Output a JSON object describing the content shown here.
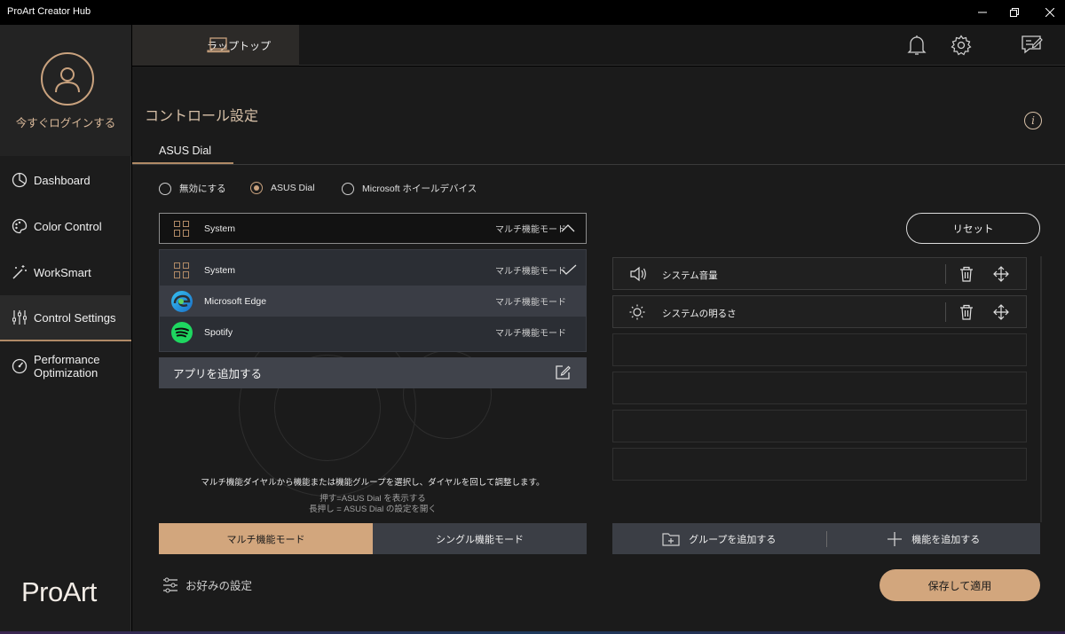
{
  "window": {
    "title": "ProArt Creator Hub"
  },
  "sidebar": {
    "login_label": "今すぐログインする",
    "items": [
      {
        "label": "Dashboard",
        "icon": "pie-chart-icon"
      },
      {
        "label": "Color Control",
        "icon": "palette-icon"
      },
      {
        "label": "WorkSmart",
        "icon": "magic-wand-icon"
      },
      {
        "label": "Control Settings",
        "icon": "sliders-icon",
        "active": true
      },
      {
        "label_line1": "Performance",
        "label_line2": "Optimization",
        "icon": "gauge-icon"
      }
    ],
    "logo": "ProArt"
  },
  "header": {
    "device_tab": "ラップトップ",
    "icons": [
      "bell-icon",
      "gear-icon",
      "feedback-icon"
    ]
  },
  "main": {
    "page_title": "コントロール設定",
    "subtab": "ASUS Dial",
    "radios": [
      {
        "label": "無効にする",
        "checked": false
      },
      {
        "label": "ASUS Dial",
        "checked": true
      },
      {
        "label": "Microsoft ホイールデバイス",
        "checked": false
      }
    ],
    "dropdown": {
      "selected_app": "System",
      "selected_mode": "マルチ機能モード",
      "options": [
        {
          "app": "System",
          "mode": "マルチ機能モード",
          "selected": true
        },
        {
          "app": "Microsoft Edge",
          "mode": "マルチ機能モード"
        },
        {
          "app": "Spotify",
          "mode": "マルチ機能モード"
        }
      ],
      "add_app": "アプリを追加する"
    },
    "help_text": "マルチ機能ダイヤルから機能または機能グループを選択し、ダイヤルを回して調整します。",
    "help_press": "押す=ASUS Dial を表示する",
    "help_long_press": "長押し = ASUS Dial の設定を開く",
    "mode_buttons": {
      "multi": "マルチ機能モード",
      "single": "シングル機能モード"
    },
    "preferences": "お好みの設定",
    "reset": "リセット",
    "functions": [
      {
        "name": "システム音量",
        "icon": "speaker-icon"
      },
      {
        "name": "システムの明るさ",
        "icon": "brightness-icon"
      }
    ],
    "add_group": "グループを追加する",
    "add_function": "機能を追加する",
    "save_apply": "保存して適用"
  },
  "colors": {
    "accent": "#d2a67d",
    "sidebar_bg": "#1c1c1c",
    "main_bg": "#1b1b1b"
  }
}
